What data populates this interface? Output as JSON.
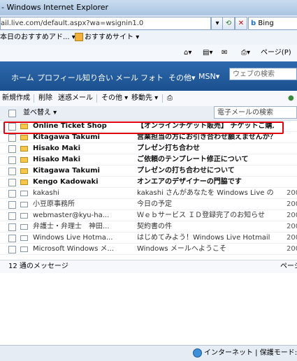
{
  "window": {
    "title": "- Windows Internet Explorer"
  },
  "address_bar": {
    "url": "ail.live.com/default.aspx?wa=wsignin1.0",
    "search_engine": "Bing"
  },
  "favorites_bar": {
    "items": [
      "本日のおすすめアド...",
      "おすすめサイト"
    ]
  },
  "command_bar": {
    "page_label": "ページ(P)"
  },
  "hotmail_nav": {
    "items": [
      "ホーム",
      "プロフィール",
      "知り合い",
      "メール",
      "フォト",
      "その他",
      "MSN"
    ],
    "search_placeholder": "ウェブの検索"
  },
  "toolbar": {
    "new": "新規作成",
    "delete": "削除",
    "junk": "迷惑メール",
    "other": "その他",
    "move": "移動先"
  },
  "list_header": {
    "sort_label": "並べ替え",
    "search_placeholder": "電子メールの検索"
  },
  "messages": [
    {
      "from": "Online Ticket Shop",
      "subject": "【オンラインチケット販売】 チケットご購入...",
      "date": "",
      "unread": true,
      "highlighted": true
    },
    {
      "from": "Kitagawa Takumi",
      "subject": "営業担当の方にお引き合わせ願えませんか？",
      "date": "",
      "unread": true
    },
    {
      "from": "Hisako Maki",
      "subject": "プレゼン打ち合わせ",
      "date": "",
      "unread": true
    },
    {
      "from": "Hisako Maki",
      "subject": "ご依頼のテンプレート修正について",
      "date": "",
      "unread": true
    },
    {
      "from": "Kitagawa Takumi",
      "subject": "プレゼンの打ち合わせについて",
      "date": "",
      "unread": true
    },
    {
      "from": "Kengo Kadowaki",
      "subject": "オンエアのデザイナーの門脇です",
      "date": "",
      "unread": true
    },
    {
      "from": "kakashi",
      "subject": "kakashi さんがあなたを Windows Live のフ...",
      "date": "200",
      "unread": false
    },
    {
      "from": "小豆原事務所",
      "subject": "今日の予定",
      "date": "200",
      "unread": false
    },
    {
      "from": "webmaster@kyu-ha...",
      "subject": "Ｗｅｂサービス ＩＤ登録完了のお知らせ",
      "date": "200",
      "unread": false
    },
    {
      "from": "弁護士・弁理士　神田...",
      "subject": "契約書の件",
      "date": "200",
      "unread": false
    },
    {
      "from": "Windows Live Hotma...",
      "subject": "はじめてみよう！Windows Live Hotmail",
      "date": "200",
      "unread": false
    },
    {
      "from": "Microsoft Windows メ...",
      "subject": "Windows メールへようこそ",
      "date": "200",
      "unread": false
    }
  ],
  "list_footer": {
    "count_text": "12 通のメッセージ",
    "page_text": "ページ"
  },
  "status_bar": {
    "zone_text": "インターネット | 保護モード: 有効"
  }
}
